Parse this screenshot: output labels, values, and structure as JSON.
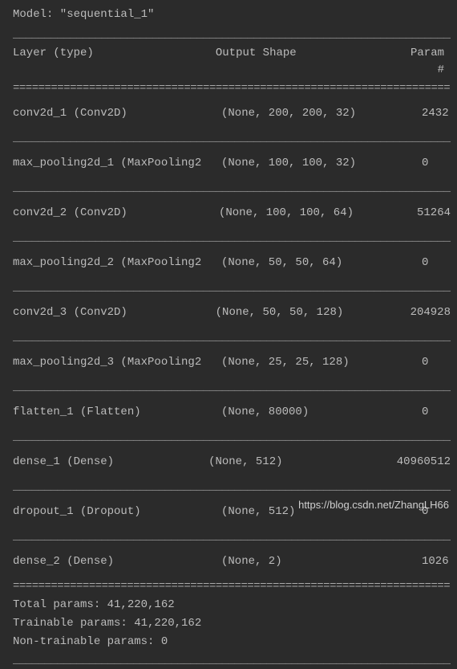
{
  "model": {
    "label": "Model: \"sequential_1\""
  },
  "header": {
    "layer": "Layer (type)",
    "output": "Output Shape",
    "param": "Param #"
  },
  "underline": "________________________________________________________________________",
  "equalsline": "========================================================================",
  "layers": [
    {
      "layer": "conv2d_1 (Conv2D)",
      "output": "(None, 200, 200, 32)",
      "param": "2432"
    },
    {
      "layer": "max_pooling2d_1 (MaxPooling2",
      "output": "(None, 100, 100, 32)",
      "param": "0"
    },
    {
      "layer": "conv2d_2 (Conv2D)",
      "output": "(None, 100, 100, 64)",
      "param": "51264"
    },
    {
      "layer": "max_pooling2d_2 (MaxPooling2",
      "output": "(None, 50, 50, 64)",
      "param": "0"
    },
    {
      "layer": "conv2d_3 (Conv2D)",
      "output": "(None, 50, 50, 128)",
      "param": "204928"
    },
    {
      "layer": "max_pooling2d_3 (MaxPooling2",
      "output": "(None, 25, 25, 128)",
      "param": "0"
    },
    {
      "layer": "flatten_1 (Flatten)",
      "output": "(None, 80000)",
      "param": "0"
    },
    {
      "layer": "dense_1 (Dense)",
      "output": "(None, 512)",
      "param": "40960512"
    },
    {
      "layer": "dropout_1 (Dropout)",
      "output": "(None, 512)",
      "param": "0"
    },
    {
      "layer": "dense_2 (Dense)",
      "output": "(None, 2)",
      "param": "1026"
    }
  ],
  "summary": {
    "total": "Total params: 41,220,162",
    "trainable": "Trainable params: 41,220,162",
    "nontrainable": "Non-trainable params: 0"
  },
  "watermark": "https://blog.csdn.net/ZhangLH66"
}
